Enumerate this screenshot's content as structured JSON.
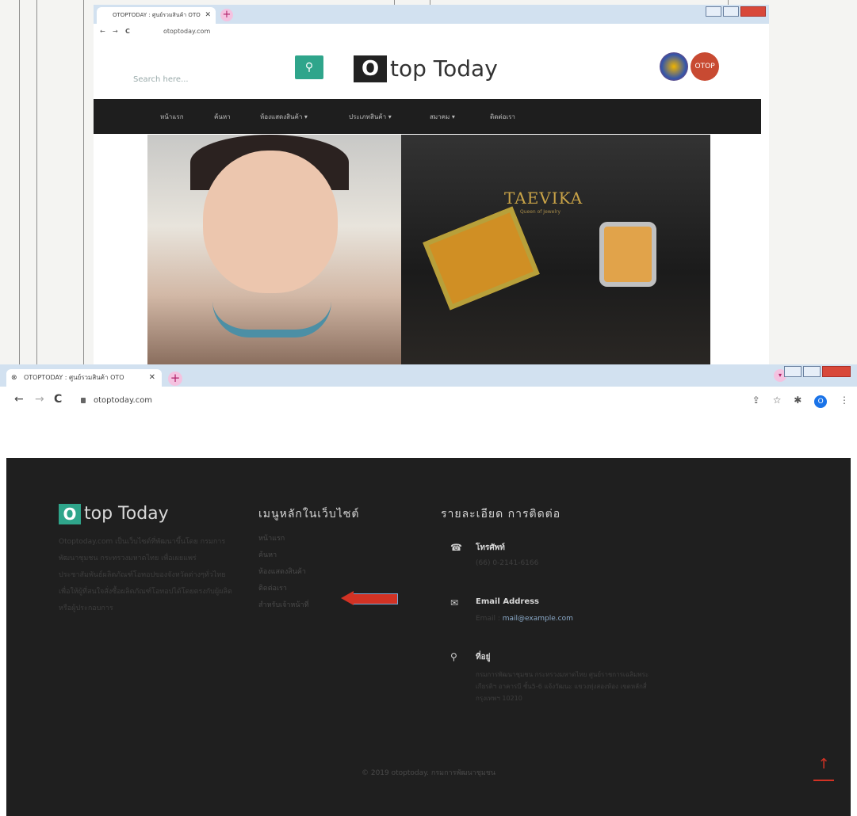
{
  "top_browser": {
    "tab_title": "OTOPTODAY : ศูนย์รวมสินค้า OTO",
    "tab_close": "✕",
    "new_tab": "+",
    "url": "otoptoday.com",
    "search_placeholder": "Search here...",
    "logo_letter": "O",
    "logo_text": "top Today",
    "badge_label": "OTOP",
    "nav": [
      "หน้าแรก",
      "ค้นหา",
      "ห้องแสดงสินค้า ▾",
      "ประเภทสินค้า ▾",
      "สมาคม ▾",
      "ติดต่อเรา"
    ],
    "hero_brand": "TAEVIKA",
    "hero_brand_sub": "Queen of Jewelry"
  },
  "bottom_browser": {
    "tab_title": "OTOPTODAY : ศูนย์รวมสินค้า OTO",
    "tab_close": "✕",
    "new_tab": "+",
    "url": "otoptoday.com",
    "avatar_letter": "O"
  },
  "footer": {
    "logo_letter": "O",
    "logo_text": "top Today",
    "description": "Otoptoday.com เป็นเว็บไซต์ที่พัฒนาขึ้นโดย กรมการพัฒนาชุมชน กระทรวงมหาดไทย เพื่อเผยแพร่ประชาสัมพันธ์ผลิตภัณฑ์โอทอปของจังหวัดต่างๆทั่วไทย เพื่อให้ผู้ที่สนใจสั่งซื้อผลิตภัณฑ์โอทอปได้โดยตรงกับผู้ผลิต หรือผู้ประกอบการ",
    "menu_title": "เมนูหลักในเว็บไซต์",
    "menu_items": [
      "หน้าแรก",
      "ค้นหา",
      "ห้องแสดงสินค้า",
      "ติดต่อเรา",
      "สำหรับเจ้าหน้าที่"
    ],
    "contact_title": "รายละเอียด การติดต่อ",
    "phone_label": "โทรศัพท์",
    "phone_value": "(66) 0-2141-6166",
    "email_label": "Email Address",
    "email_prefix": "Email :",
    "email_value": "mail@example.com",
    "address_label": "ที่อยู่",
    "address_value": "กรมการพัฒนาชุมชน กระทรวงมหาดไทย ศูนย์ราชการเฉลิมพระเกียรติฯ อาคารบี ชั้น5-6 แจ้งวัฒนะ แขวงทุ่งสองห้อง เขตหลักสี่ กรุงเทพฯ 10210",
    "copyright": "© 2019 otoptoday. กรมการพัฒนาชุมชน",
    "to_top": "↑"
  },
  "icons": {
    "back": "←",
    "forward": "→",
    "reload": "C",
    "phone": "☎",
    "email": "✉",
    "location": "⚲",
    "share": "⇪",
    "star": "☆",
    "extension": "✱",
    "menu": "⋮",
    "search": "⚲"
  },
  "colors": {
    "accent": "#2fa58b",
    "footer_bg": "#1f1f1f",
    "arrow": "#d23224",
    "tabbar": "#d2e1f0"
  }
}
